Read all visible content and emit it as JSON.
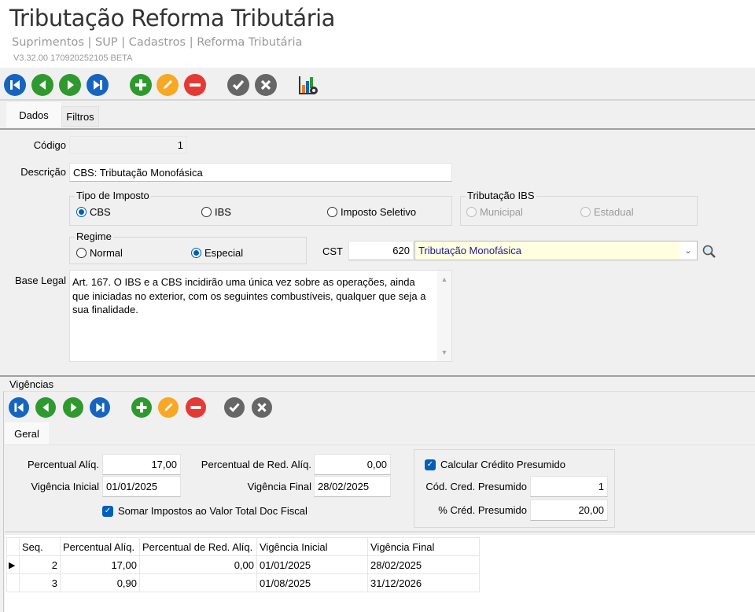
{
  "header": {
    "title": "Tributação Reforma Tributária",
    "breadcrumb": "Suprimentos | SUP | Cadastros | Reforma Tributária",
    "version": "V3.32.00 170920252105 BETA"
  },
  "toolbar": {
    "icons": [
      "first-icon",
      "previous-icon",
      "next-icon",
      "last-icon",
      "add-icon",
      "edit-icon",
      "delete-icon",
      "confirm-icon",
      "cancel-icon",
      "report-settings-icon"
    ]
  },
  "tabs": [
    {
      "label": "Dados",
      "active": true
    },
    {
      "label": "Filtros",
      "active": false
    }
  ],
  "form": {
    "codigo_label": "Código",
    "codigo": "1",
    "descricao_label": "Descrição",
    "descricao": "CBS: Tributação Monofásica",
    "tipo_imposto": {
      "caption": "Tipo de Imposto",
      "options": [
        "CBS",
        "IBS",
        "Imposto Seletivo"
      ],
      "selected": "CBS"
    },
    "tributacao_ibs": {
      "caption": "Tributação IBS",
      "options": [
        "Municipal",
        "Estadual"
      ],
      "enabled": false
    },
    "regime": {
      "caption": "Regime",
      "options": [
        "Normal",
        "Especial"
      ],
      "selected": "Especial"
    },
    "cst_label": "CST",
    "cst_code": "620",
    "cst_desc": "Tributação Monofásica",
    "base_legal_label": "Base Legal",
    "base_legal": "Art. 167. O IBS e a CBS incidirão uma única vez sobre as operações, ainda que iniciadas no exterior, com os seguintes combustíveis, qualquer que seja a sua finalidade."
  },
  "vigencias": {
    "label": "Vigências",
    "tab": "Geral",
    "perc_aliq_label": "Percentual Alíq.",
    "perc_aliq": "17,00",
    "perc_red_label": "Percentual de Red. Alíq.",
    "perc_red": "0,00",
    "vig_ini_label": "Vigência Inicial",
    "vig_ini": "01/01/2025",
    "vig_fim_label": "Vigência Final",
    "vig_fim": "28/02/2025",
    "somar_label": "Somar Impostos ao Valor Total Doc Fiscal",
    "somar": true,
    "calc_cred_label": "Calcular Crédito Presumido",
    "calc_cred": true,
    "cod_cred_label": "Cód. Cred. Presumido",
    "cod_cred": "1",
    "perc_cred_label": "% Créd. Presumido",
    "perc_cred": "20,00",
    "grid": {
      "columns": [
        "Seq.",
        "Percentual Alíq.",
        "Percentual de Red. Alíq.",
        "Vigência Inicial",
        "Vigência Final"
      ],
      "rows": [
        [
          "2",
          "17,00",
          "0,00",
          "01/01/2025",
          "28/02/2025"
        ],
        [
          "3",
          "0,90",
          "",
          "01/08/2025",
          "31/12/2026"
        ]
      ]
    }
  },
  "colors": {
    "blue": "#1565c0",
    "green": "#2e9a2e",
    "orange": "#f9a825",
    "red": "#e53935",
    "gray": "#666666",
    "cst_bg": "#ffffe0",
    "cst_text": "#1a1aa6"
  }
}
